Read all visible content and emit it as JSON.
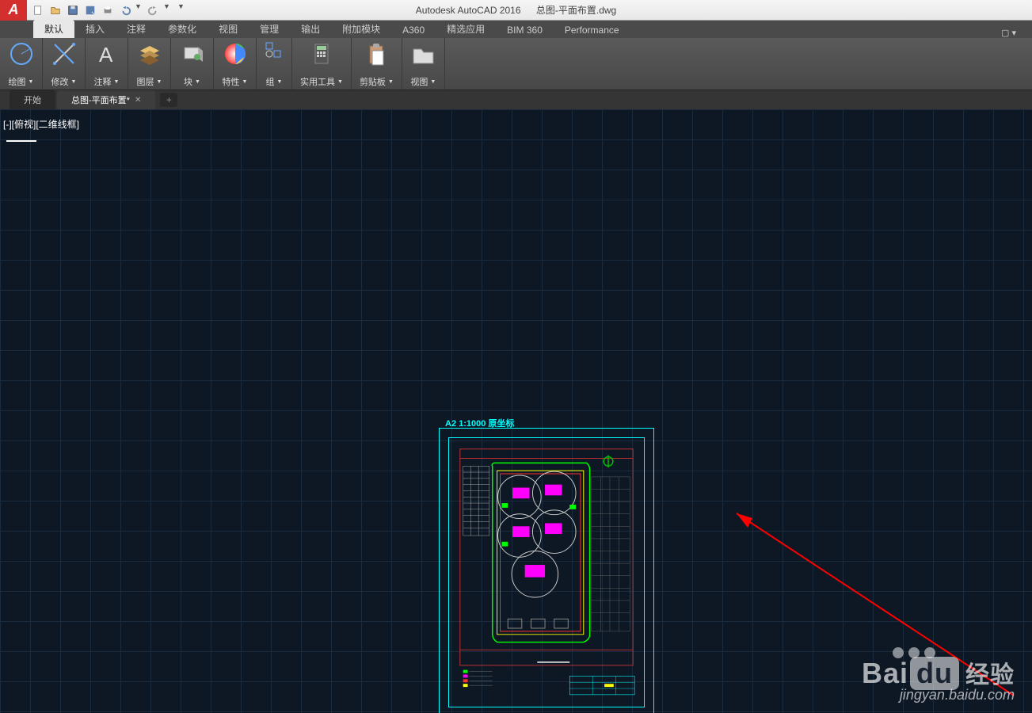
{
  "title": {
    "app": "Autodesk AutoCAD 2016",
    "file": "总图-平面布置.dwg"
  },
  "ribbon_tabs": [
    "默认",
    "插入",
    "注释",
    "参数化",
    "视图",
    "管理",
    "输出",
    "附加模块",
    "A360",
    "精选应用",
    "BIM 360",
    "Performance"
  ],
  "ribbon_active": 0,
  "panels": {
    "draw": "绘图",
    "modify": "修改",
    "annot": "注释",
    "layer": "图层",
    "block": "块",
    "prop": "特性",
    "group": "组",
    "util": "实用工具",
    "clip": "剪贴板",
    "view": "视图"
  },
  "filetabs": {
    "start": "开始",
    "doc": "总图-平面布置*"
  },
  "viewport_label": "[-][俯视][二维线框]",
  "sheet_label": "A2  1:1000   原坐标",
  "watermark": {
    "brand": "Bai",
    "du": "du",
    "exp": "经验",
    "url": "jingyan.baidu.com"
  }
}
